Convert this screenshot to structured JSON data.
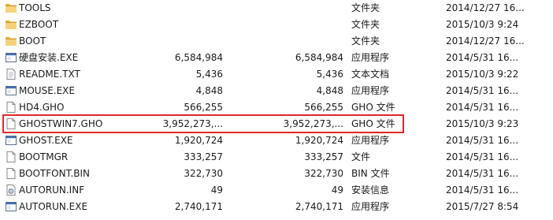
{
  "accent": {
    "highlight_border": "#e0282d",
    "folder": "#f2c14e"
  },
  "files": [
    {
      "name": "TOOLS",
      "size": "",
      "packed": "",
      "type": "文件夹",
      "date": "2014/12/27 16...",
      "icon": "folder-icon"
    },
    {
      "name": "EZBOOT",
      "size": "",
      "packed": "",
      "type": "文件夹",
      "date": "2015/10/3 9:24",
      "icon": "folder-icon"
    },
    {
      "name": "BOOT",
      "size": "",
      "packed": "",
      "type": "文件夹",
      "date": "2014/12/27 16...",
      "icon": "folder-icon"
    },
    {
      "name": "硬盘安装.EXE",
      "size": "6,584,984",
      "packed": "6,584,984",
      "type": "应用程序",
      "date": "2014/5/31 16...",
      "icon": "exe-window-icon"
    },
    {
      "name": "README.TXT",
      "size": "5,436",
      "packed": "5,436",
      "type": "文本文档",
      "date": "2015/10/3 9:22",
      "icon": "text-document-icon"
    },
    {
      "name": "MOUSE.EXE",
      "size": "4,848",
      "packed": "4,848",
      "type": "应用程序",
      "date": "2014/5/31 16...",
      "icon": "exe-window-icon"
    },
    {
      "name": "HD4.GHO",
      "size": "566,255",
      "packed": "566,255",
      "type": "GHO 文件",
      "date": "2014/5/31 16...",
      "icon": "blank-file-icon"
    },
    {
      "name": "GHOSTWIN7.GHO",
      "size": "3,952,273,...",
      "packed": "3,952,273,...",
      "type": "GHO 文件",
      "date": "2015/10/3 9:23",
      "icon": "blank-file-icon"
    },
    {
      "name": "GHOST.EXE",
      "size": "1,920,724",
      "packed": "1,920,724",
      "type": "应用程序",
      "date": "2014/5/31 16...",
      "icon": "exe-window-icon"
    },
    {
      "name": "BOOTMGR",
      "size": "333,257",
      "packed": "333,257",
      "type": "文件",
      "date": "2014/5/31 16...",
      "icon": "blank-file-icon"
    },
    {
      "name": "BOOTFONT.BIN",
      "size": "322,730",
      "packed": "322,730",
      "type": "BIN 文件",
      "date": "2014/5/31 16...",
      "icon": "blank-file-icon"
    },
    {
      "name": "AUTORUN.INF",
      "size": "49",
      "packed": "49",
      "type": "安装信息",
      "date": "2014/5/31 16...",
      "icon": "settings-file-icon"
    },
    {
      "name": "AUTORUN.EXE",
      "size": "2,740,171",
      "packed": "2,740,171",
      "type": "应用程序",
      "date": "2015/7/27 8:54",
      "icon": "exe-window-icon"
    }
  ]
}
